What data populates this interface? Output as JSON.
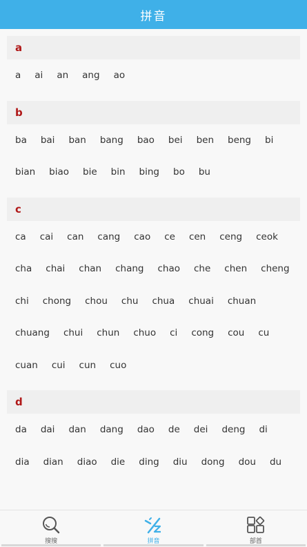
{
  "header": {
    "title": "拼音"
  },
  "sections": [
    {
      "letter": "a",
      "rows": [
        [
          "a",
          "ai",
          "an",
          "ang",
          "ao"
        ]
      ]
    },
    {
      "letter": "b",
      "rows": [
        [
          "ba",
          "bai",
          "ban",
          "bang",
          "bao",
          "bei",
          "ben",
          "beng",
          "bi"
        ],
        [
          "bian",
          "biao",
          "bie",
          "bin",
          "bing",
          "bo",
          "bu"
        ]
      ]
    },
    {
      "letter": "c",
      "rows": [
        [
          "ca",
          "cai",
          "can",
          "cang",
          "cao",
          "ce",
          "cen",
          "ceng",
          "ceok"
        ],
        [
          "cha",
          "chai",
          "chan",
          "chang",
          "chao",
          "che",
          "chen",
          "cheng"
        ],
        [
          "chi",
          "chong",
          "chou",
          "chu",
          "chua",
          "chuai",
          "chuan"
        ],
        [
          "chuang",
          "chui",
          "chun",
          "chuo",
          "ci",
          "cong",
          "cou",
          "cu"
        ],
        [
          "cuan",
          "cui",
          "cun",
          "cuo"
        ]
      ]
    },
    {
      "letter": "d",
      "rows": [
        [
          "da",
          "dai",
          "dan",
          "dang",
          "dao",
          "de",
          "dei",
          "deng",
          "di"
        ],
        [
          "dia",
          "dian",
          "diao",
          "die",
          "ding",
          "diu",
          "dong",
          "dou",
          "du"
        ]
      ]
    }
  ],
  "tabs": [
    {
      "label": "搜搜",
      "icon": "search-icon",
      "active": false
    },
    {
      "label": "拼音",
      "icon": "pinyin-icon",
      "active": true
    },
    {
      "label": "部首",
      "icon": "radical-grid-icon",
      "active": false
    }
  ],
  "colors": {
    "accent": "#3fb0e8",
    "letter": "#b01818"
  }
}
